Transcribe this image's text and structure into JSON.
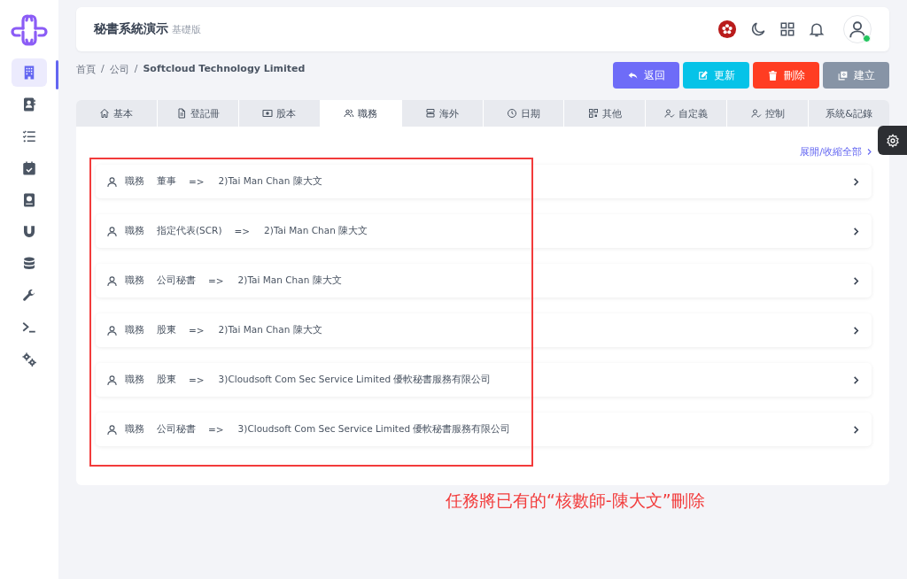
{
  "header": {
    "title": "秘書系統演示",
    "edition": "基礎版",
    "user_online": true
  },
  "sidebar": {
    "items": [
      {
        "selected": true
      },
      {
        "selected": false
      },
      {
        "selected": false
      },
      {
        "selected": false
      },
      {
        "selected": false
      },
      {
        "selected": false
      },
      {
        "selected": false
      },
      {
        "selected": false
      },
      {
        "selected": false
      },
      {
        "selected": false
      }
    ]
  },
  "breadcrumb": {
    "separator": "/",
    "items": [
      "首頁",
      "公司",
      "Softcloud Technology Limited"
    ]
  },
  "actions": [
    {
      "label": "返回",
      "kind": "back"
    },
    {
      "label": "更新",
      "kind": "update"
    },
    {
      "label": "刪除",
      "kind": "delete"
    },
    {
      "label": "建立",
      "kind": "create"
    }
  ],
  "tabs": [
    {
      "label": "基本",
      "selected": false
    },
    {
      "label": "登記冊",
      "selected": false
    },
    {
      "label": "股本",
      "selected": false
    },
    {
      "label": "職務",
      "selected": true
    },
    {
      "label": "海外",
      "selected": false
    },
    {
      "label": "日期",
      "selected": false
    },
    {
      "label": "其他",
      "selected": false
    },
    {
      "label": "自定義",
      "selected": false
    },
    {
      "label": "控制",
      "selected": false
    },
    {
      "label": "系統&記錄",
      "selected": false
    }
  ],
  "expand_all": "展開/收縮全部",
  "positions": [
    {
      "label": "職務",
      "role": "董事",
      "arrow": "=>",
      "person": "2)Tai Man Chan 陳大文"
    },
    {
      "label": "職務",
      "role": "指定代表(SCR)",
      "arrow": "=>",
      "person": "2)Tai Man Chan 陳大文"
    },
    {
      "label": "職務",
      "role": "公司秘書",
      "arrow": "=>",
      "person": "2)Tai Man Chan 陳大文"
    },
    {
      "label": "職務",
      "role": "股東",
      "arrow": "=>",
      "person": "2)Tai Man Chan 陳大文"
    },
    {
      "label": "職務",
      "role": "股東",
      "arrow": "=>",
      "person": "3)Cloudsoft Com Sec Service Limited 優軟秘書服務有限公司"
    },
    {
      "label": "職務",
      "role": "公司秘書",
      "arrow": "=>",
      "person": "3)Cloudsoft Com Sec Service Limited 優軟秘書服務有限公司"
    }
  ],
  "annotation": {
    "text": "任務將已有的“核數師-陳大文”刪除"
  }
}
